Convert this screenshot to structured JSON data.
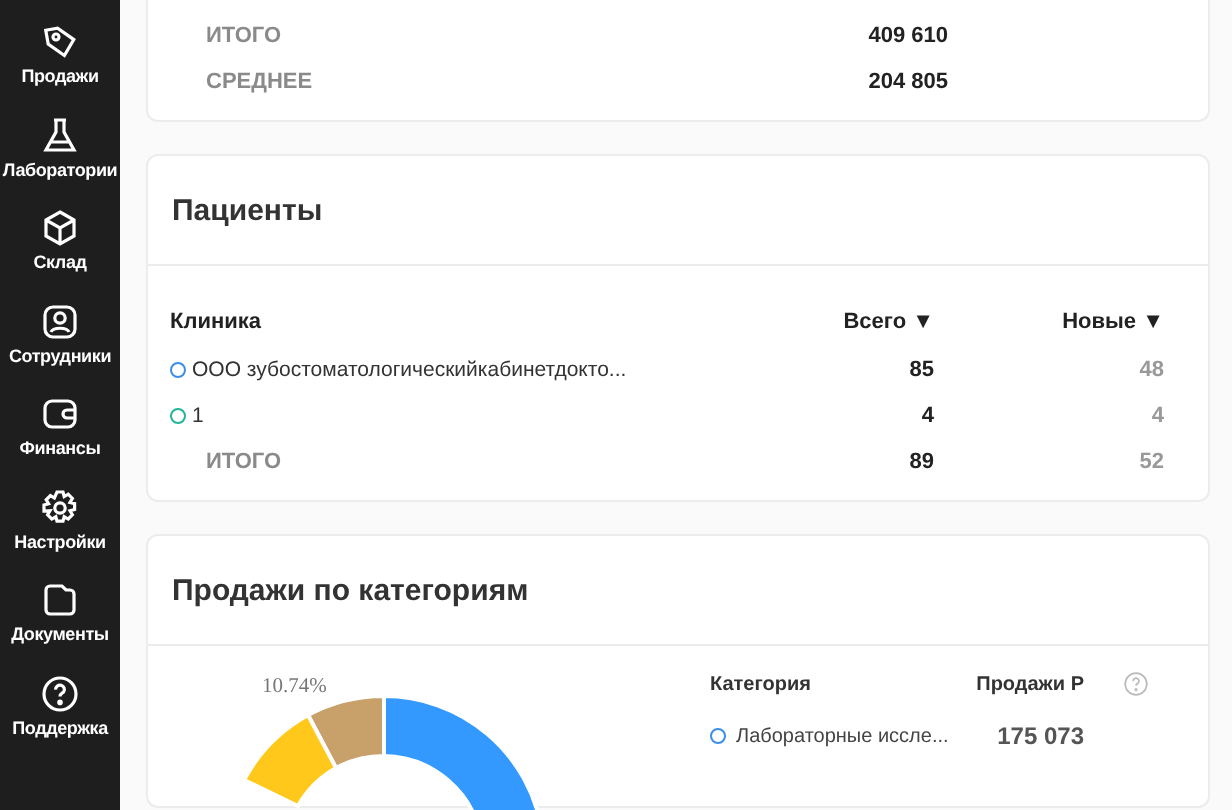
{
  "sidebar": {
    "items": [
      {
        "label": "Продажи",
        "kind": "tag"
      },
      {
        "label": "Лаборатории",
        "kind": "flask"
      },
      {
        "label": "Склад",
        "kind": "box"
      },
      {
        "label": "Сотрудники",
        "kind": "person"
      },
      {
        "label": "Финансы",
        "kind": "wallet"
      },
      {
        "label": "Настройки",
        "kind": "gear"
      },
      {
        "label": "Документы",
        "kind": "folder"
      },
      {
        "label": "Поддержка",
        "kind": "help"
      }
    ]
  },
  "summary": {
    "rows": [
      {
        "label": "ИТОГО",
        "value": "409 610"
      },
      {
        "label": "СРЕДНЕЕ",
        "value": "204 805"
      }
    ]
  },
  "patients": {
    "title": "Пациенты",
    "columns": [
      "Клиника",
      "Всего ▼",
      "Новые ▼"
    ],
    "rows": [
      {
        "name": "ООО зубостоматологическийкабинетдокто...",
        "total": "85",
        "new": "48",
        "color": "#3b8fe8"
      },
      {
        "name": "1",
        "total": "4",
        "new": "4",
        "color": "#22b59a"
      }
    ],
    "total": {
      "label": "ИТОГО",
      "total": "89",
      "new": "52"
    }
  },
  "categories": {
    "title": "Продажи по категориям",
    "donut_label": "10.74%",
    "columns": [
      "Категория",
      "Продажи Р"
    ],
    "rows": [
      {
        "name": "Лабораторные иссле...",
        "value": "175 073",
        "color": "#3b8fe8"
      }
    ]
  }
}
